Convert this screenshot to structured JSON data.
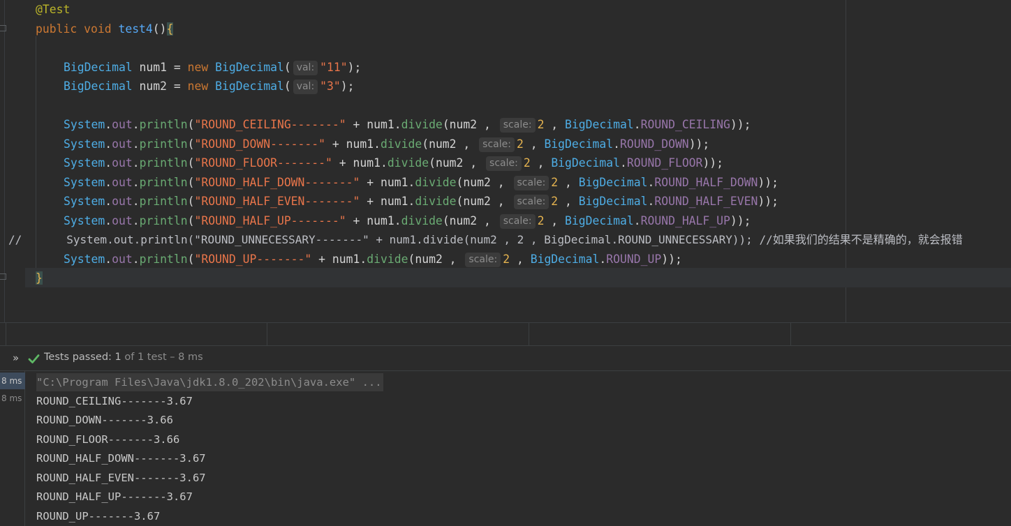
{
  "editor": {
    "lines": {
      "l1": {
        "annotation": "@Test"
      },
      "l2": {
        "kw1": "public",
        "kw2": "void",
        "method": "test4",
        "parens": "()",
        "brace": "{"
      },
      "l3": {
        "type": "BigDecimal",
        "var": " num1 = ",
        "kw": "new",
        "ctor": "BigDecimal",
        "open": "(",
        "hint": "val:",
        "str": "\"11\"",
        "close": ");"
      },
      "l4": {
        "type": "BigDecimal",
        "var": " num2 = ",
        "kw": "new",
        "ctor": "BigDecimal",
        "open": "(",
        "hint": "val:",
        "str": "\"3\"",
        "close": ");"
      },
      "p1": {
        "sys": "System",
        "dot1": ".",
        "out": "out",
        "dot2": ".",
        "println": "println",
        "open": "(",
        "str": "\"ROUND_CEILING-------\"",
        "mid": " + num1.",
        "divide": "divide",
        "args": "(num2 , ",
        "hint": "scale:",
        "num": "2",
        "sep": " , ",
        "cls": "BigDecimal",
        "dot3": ".",
        "const": "ROUND_CEILING",
        "end": "));"
      },
      "p2": {
        "sys": "System",
        "dot1": ".",
        "out": "out",
        "dot2": ".",
        "println": "println",
        "open": "(",
        "str": "\"ROUND_DOWN-------\"",
        "mid": " + num1.",
        "divide": "divide",
        "args": "(num2 , ",
        "hint": "scale:",
        "num": "2",
        "sep": " , ",
        "cls": "BigDecimal",
        "dot3": ".",
        "const": "ROUND_DOWN",
        "end": "));"
      },
      "p3": {
        "sys": "System",
        "dot1": ".",
        "out": "out",
        "dot2": ".",
        "println": "println",
        "open": "(",
        "str": "\"ROUND_FLOOR-------\"",
        "mid": " + num1.",
        "divide": "divide",
        "args": "(num2 , ",
        "hint": "scale:",
        "num": "2",
        "sep": " , ",
        "cls": "BigDecimal",
        "dot3": ".",
        "const": "ROUND_FLOOR",
        "end": "));"
      },
      "p4": {
        "sys": "System",
        "dot1": ".",
        "out": "out",
        "dot2": ".",
        "println": "println",
        "open": "(",
        "str": "\"ROUND_HALF_DOWN-------\"",
        "mid": " + num1.",
        "divide": "divide",
        "args": "(num2 , ",
        "hint": "scale:",
        "num": "2",
        "sep": " , ",
        "cls": "BigDecimal",
        "dot3": ".",
        "const": "ROUND_HALF_DOWN",
        "end": "));"
      },
      "p5": {
        "sys": "System",
        "dot1": ".",
        "out": "out",
        "dot2": ".",
        "println": "println",
        "open": "(",
        "str": "\"ROUND_HALF_EVEN-------\"",
        "mid": " + num1.",
        "divide": "divide",
        "args": "(num2 , ",
        "hint": "scale:",
        "num": "2",
        "sep": " , ",
        "cls": "BigDecimal",
        "dot3": ".",
        "const": "ROUND_HALF_EVEN",
        "end": "));"
      },
      "p6": {
        "sys": "System",
        "dot1": ".",
        "out": "out",
        "dot2": ".",
        "println": "println",
        "open": "(",
        "str": "\"ROUND_HALF_UP-------\"",
        "mid": " + num1.",
        "divide": "divide",
        "args": "(num2 , ",
        "hint": "scale:",
        "num": "2",
        "sep": " , ",
        "cls": "BigDecimal",
        "dot3": ".",
        "const": "ROUND_HALF_UP",
        "end": "));"
      },
      "comment": {
        "slashes": "//",
        "text": "System.out.println(\"ROUND_UNNECESSARY-------\" + num1.divide(num2 , 2 , BigDecimal.ROUND_UNNECESSARY)); //如果我们的结果不是精确的，就会报错"
      },
      "p7": {
        "sys": "System",
        "dot1": ".",
        "out": "out",
        "dot2": ".",
        "println": "println",
        "open": "(",
        "str": "\"ROUND_UP-------\"",
        "mid": " + num1.",
        "divide": "divide",
        "args": "(num2 , ",
        "hint": "scale:",
        "num": "2",
        "sep": " , ",
        "cls": "BigDecimal",
        "dot3": ".",
        "const": "ROUND_UP",
        "end": "));"
      },
      "close": {
        "brace": "}"
      }
    }
  },
  "toolbar": {
    "expand_icon": "»",
    "status_prefix": "Tests passed: ",
    "passed": "1",
    "status_rest": " of 1 test – 8 ms"
  },
  "console": {
    "times": [
      "8 ms",
      "8 ms"
    ],
    "command": "\"C:\\Program Files\\Java\\jdk1.8.0_202\\bin\\java.exe\" ...",
    "output": [
      "ROUND_CEILING-------3.67",
      "ROUND_DOWN-------3.66",
      "ROUND_FLOOR-------3.66",
      "ROUND_HALF_DOWN-------3.67",
      "ROUND_HALF_EVEN-------3.67",
      "ROUND_HALF_UP-------3.67",
      "ROUND_UP-------3.67"
    ]
  },
  "colors": {
    "pass_green": "#5fb865",
    "editor_bg": "#2b2b2b"
  }
}
